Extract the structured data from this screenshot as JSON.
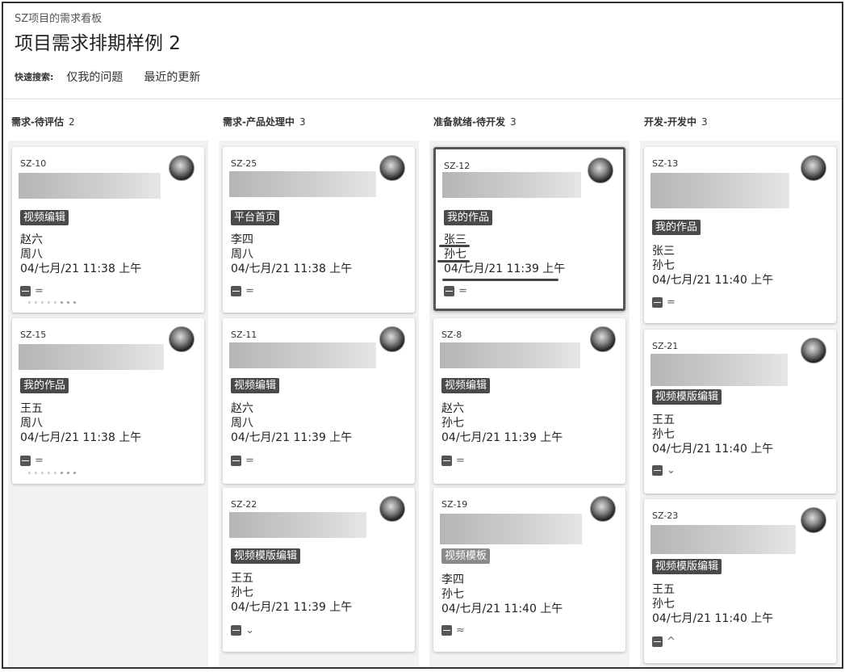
{
  "header": {
    "breadcrumb": "SZ项目的需求看板",
    "title": "项目需求排期样例 2",
    "quick_filter_label": "快速搜索:",
    "quick_filters": [
      "仅我的问题",
      "最近的更新"
    ]
  },
  "columns": [
    {
      "name": "需求-待评估",
      "count": "2",
      "cards": [
        {
          "key": "SZ-10",
          "label": "视频编辑",
          "assignee": "赵六",
          "reporter": "周八",
          "date": "04/七月/21 11:38 上午",
          "priority": "="
        },
        {
          "key": "SZ-15",
          "label": "我的作品",
          "assignee": "王五",
          "reporter": "周八",
          "date": "04/七月/21 11:38 上午",
          "priority": "="
        }
      ]
    },
    {
      "name": "需求-产品处理中",
      "count": "3",
      "cards": [
        {
          "key": "SZ-25",
          "label": "平台首页",
          "assignee": "李四",
          "reporter": "周八",
          "date": "04/七月/21 11:38 上午",
          "priority": "="
        },
        {
          "key": "SZ-11",
          "label": "视频编辑",
          "assignee": "赵六",
          "reporter": "周八",
          "date": "04/七月/21 11:39 上午",
          "priority": "="
        },
        {
          "key": "SZ-22",
          "label": "视频模版编辑",
          "assignee": "王五",
          "reporter": "孙七",
          "date": "04/七月/21 11:39 上午",
          "priority": "⌄"
        }
      ]
    },
    {
      "name": "准备就绪-待开发",
      "count": "3",
      "cards": [
        {
          "key": "SZ-12",
          "label": "我的作品",
          "assignee": "张三",
          "reporter": "孙七",
          "date": "04/七月/21 11:39 上午",
          "priority": "="
        },
        {
          "key": "SZ-8",
          "label": "视频编辑",
          "assignee": "赵六",
          "reporter": "孙七",
          "date": "04/七月/21 11:39 上午",
          "priority": "="
        },
        {
          "key": "SZ-19",
          "label": "视频模板",
          "assignee": "李四",
          "reporter": "孙七",
          "date": "04/七月/21 11:40 上午",
          "priority": "≈"
        }
      ]
    },
    {
      "name": "开发-开发中",
      "count": "3",
      "cards": [
        {
          "key": "SZ-13",
          "label": "我的作品",
          "assignee": "张三",
          "reporter": "孙七",
          "date": "04/七月/21 11:40 上午",
          "priority": "="
        },
        {
          "key": "SZ-21",
          "label": "视频模版编辑",
          "assignee": "王五",
          "reporter": "孙七",
          "date": "04/七月/21 11:40 上午",
          "priority": "⌄"
        },
        {
          "key": "SZ-23",
          "label": "视频模版编辑",
          "assignee": "王五",
          "reporter": "孙七",
          "date": "04/七月/21 11:40 上午",
          "priority": "^"
        }
      ]
    }
  ]
}
